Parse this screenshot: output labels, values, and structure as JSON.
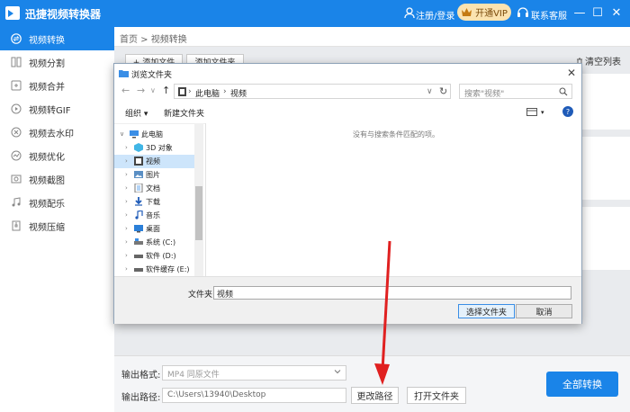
{
  "app": {
    "title": "迅捷视频转换器",
    "login": "注册/登录",
    "vip": "开通VIP",
    "support": "联系客服",
    "minimize": "—",
    "maximize": "☐",
    "close": "✕"
  },
  "sidebar": {
    "items": [
      {
        "label": "视频转换",
        "icon": "video-convert-icon"
      },
      {
        "label": "视频分割",
        "icon": "video-split-icon"
      },
      {
        "label": "视频合并",
        "icon": "video-merge-icon"
      },
      {
        "label": "视频转GIF",
        "icon": "gif-icon"
      },
      {
        "label": "视频去水印",
        "icon": "watermark-icon"
      },
      {
        "label": "视频优化",
        "icon": "optimize-icon"
      },
      {
        "label": "视频截图",
        "icon": "screenshot-icon"
      },
      {
        "label": "视频配乐",
        "icon": "music-icon"
      },
      {
        "label": "视频压缩",
        "icon": "compress-icon"
      }
    ]
  },
  "main": {
    "breadcrumb": "首页 > 视频转换",
    "clear_list": "清空列表",
    "add_file": "+ 添加文件",
    "add_folder": "添加文件夹",
    "output_format_label": "输出格式:",
    "output_format_value": "MP4  同原文件",
    "output_path_label": "输出路径:",
    "output_path_value": "C:\\Users\\13940\\Desktop",
    "change_path": "更改路径",
    "open_folder": "打开文件夹",
    "convert_all": "全部转换"
  },
  "dialog": {
    "title": "浏览文件夹",
    "close": "✕",
    "address": [
      "此电脑",
      "视频"
    ],
    "search_placeholder": "搜索\"视频\"",
    "organize": "组织 ▾",
    "new_folder": "新建文件夹",
    "empty_message": "没有与搜索条件匹配的项。",
    "tree": [
      {
        "label": "此电脑",
        "icon": "computer-icon",
        "level": 0
      },
      {
        "label": "3D 对象",
        "icon": "3d-objects-icon",
        "level": 1
      },
      {
        "label": "视频",
        "icon": "video-folder-icon",
        "level": 1,
        "selected": true
      },
      {
        "label": "图片",
        "icon": "pictures-icon",
        "level": 1
      },
      {
        "label": "文档",
        "icon": "documents-icon",
        "level": 1
      },
      {
        "label": "下载",
        "icon": "download-icon",
        "level": 1
      },
      {
        "label": "音乐",
        "icon": "music-note-icon",
        "level": 1
      },
      {
        "label": "桌面",
        "icon": "desktop-icon",
        "level": 1
      },
      {
        "label": "系统 (C:)",
        "icon": "drive-c-icon",
        "level": 1
      },
      {
        "label": "软件 (D:)",
        "icon": "drive-d-icon",
        "level": 1
      },
      {
        "label": "软件缓存 (E:)",
        "icon": "drive-e-icon",
        "level": 1
      }
    ],
    "filename_label": "文件夹:",
    "filename_value": "视频",
    "select_folder": "选择文件夹",
    "cancel": "取消"
  },
  "colors": {
    "brand_blue": "#1a84e8",
    "vip_bg": "#fbe3b0",
    "annotation_red": "#e02020"
  }
}
